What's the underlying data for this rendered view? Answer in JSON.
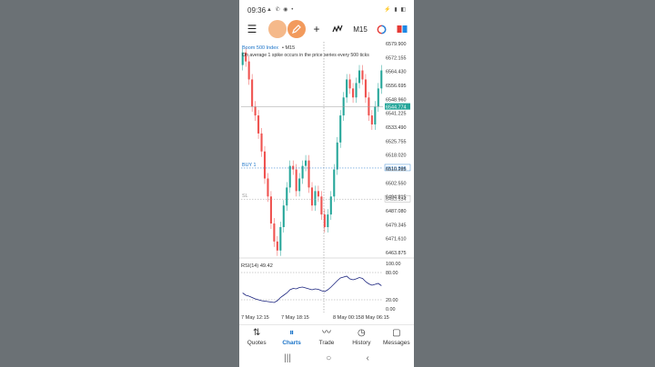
{
  "status": {
    "time": "09:36",
    "left_icons": "▲ ✆ ◉ •",
    "right_icons": "⚡ ▮ ◧"
  },
  "toolbar": {
    "menu_icon": "☰",
    "crosshair_icon": "+",
    "indicator_icon": "ƒ",
    "timeframe": "M15",
    "colors": {
      "objects_button": "#f5b98a",
      "draw_button": "#f29a5c"
    }
  },
  "chart": {
    "symbol": "Boom 500 Index",
    "timeframe_label": "• M15",
    "description": "On average 1 spike occurs in the price series every 500 ticks",
    "buy_label": "BUY 1",
    "sl_label": "SL",
    "current_price": "6544.774",
    "buy_price": "6510.806",
    "sl_price": "6493.534",
    "price_labels": [
      "6579.900",
      "6572.155",
      "6564.430",
      "6556.695",
      "6548.960",
      "6541.225",
      "6533.490",
      "6525.755",
      "6518.020",
      "6510.285",
      "6502.550",
      "6494.815",
      "6487.080",
      "6479.345",
      "6471.610",
      "6463.875"
    ],
    "rsi_label": "RSI(14) 49.42",
    "rsi_levels": [
      "100.00",
      "80.00",
      "20.00",
      "0.00"
    ],
    "time_labels": [
      "7 May 12:15",
      "7 May 18:15",
      "8 May 00:15",
      "8 May 06:15"
    ],
    "colors": {
      "bull": "#26a69a",
      "bear": "#ef5350",
      "rsi": "#1a237e",
      "grid": "#9a9a9a",
      "current_price_bg": "#26a69a"
    }
  },
  "chart_data": {
    "type": "candlestick",
    "ylim": [
      6463.875,
      6579.9
    ],
    "candles_close": [
      6575,
      6570,
      6560,
      6545,
      6540,
      6530,
      6520,
      6505,
      6495,
      6480,
      6470,
      6465,
      6478,
      6490,
      6500,
      6512,
      6510,
      6498,
      6505,
      6512,
      6515,
      6500,
      6490,
      6498,
      6495,
      6485,
      6478,
      6485,
      6495,
      6510,
      6525,
      6540,
      6550,
      6560,
      6555,
      6550,
      6558,
      6565,
      6560,
      6550,
      6540,
      6535,
      6545,
      6555,
      6565
    ],
    "candles_open": [
      6568,
      6575,
      6570,
      6560,
      6545,
      6540,
      6530,
      6520,
      6505,
      6495,
      6480,
      6470,
      6465,
      6478,
      6490,
      6500,
      6512,
      6510,
      6498,
      6505,
      6512,
      6515,
      6500,
      6490,
      6498,
      6495,
      6485,
      6478,
      6485,
      6495,
      6510,
      6525,
      6540,
      6550,
      6560,
      6555,
      6550,
      6558,
      6565,
      6560,
      6550,
      6540,
      6535,
      6545,
      6555
    ],
    "rsi": {
      "ylim": [
        0,
        100
      ],
      "values": [
        35,
        30,
        28,
        25,
        22,
        20,
        18,
        17,
        16,
        15,
        14,
        18,
        25,
        30,
        35,
        42,
        45,
        44,
        47,
        48,
        46,
        44,
        42,
        44,
        43,
        40,
        38,
        42,
        48,
        55,
        62,
        68,
        70,
        72,
        66,
        64,
        66,
        69,
        67,
        60,
        55,
        52,
        54,
        56,
        51
      ]
    }
  },
  "nav": {
    "items": [
      {
        "label": "Quotes",
        "icon": "⇅"
      },
      {
        "label": "Charts",
        "icon": "⏸"
      },
      {
        "label": "Trade",
        "icon": "〰"
      },
      {
        "label": "History",
        "icon": "◷"
      },
      {
        "label": "Messages",
        "icon": "▢"
      }
    ]
  },
  "sysnav": {
    "recent": "|||",
    "home": "○",
    "back": "‹"
  }
}
